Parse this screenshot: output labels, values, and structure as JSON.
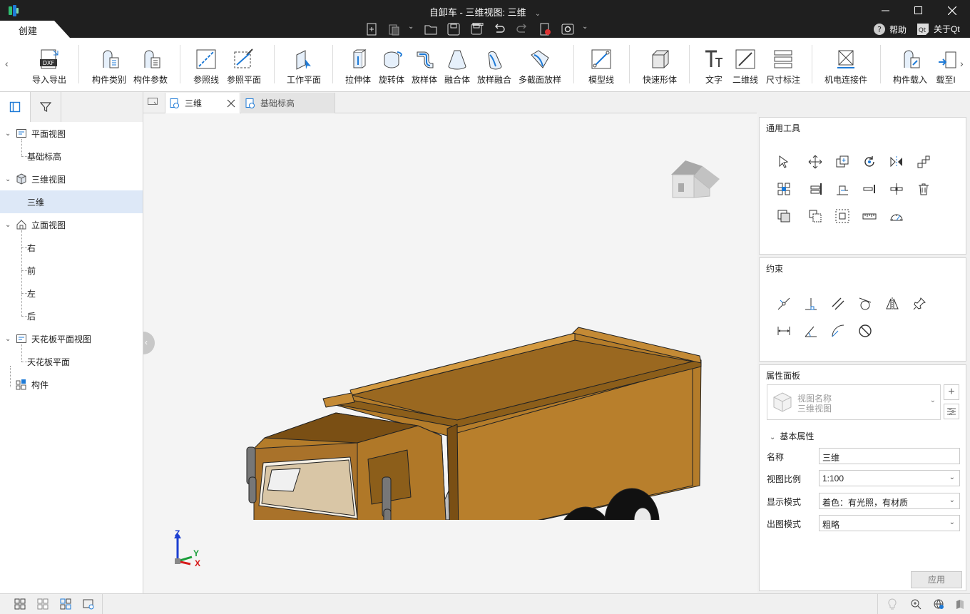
{
  "window": {
    "title": "自卸车 - 三维视图: 三维",
    "accent": "#1e7ad6"
  },
  "ribbon_tab": "创建",
  "help": {
    "help_label": "帮助",
    "about_label": "关于Qt"
  },
  "ribbon": {
    "buttons": [
      {
        "label": "导入导出",
        "icon": "dxf-icon"
      },
      {
        "label": "构件类别",
        "icon": "component-category-icon"
      },
      {
        "label": "构件参数",
        "icon": "component-params-icon"
      },
      {
        "label": "参照线",
        "icon": "reference-line-icon"
      },
      {
        "label": "参照平面",
        "icon": "reference-plane-icon"
      },
      {
        "label": "工作平面",
        "icon": "work-plane-icon"
      },
      {
        "label": "拉伸体",
        "icon": "extrusion-icon"
      },
      {
        "label": "旋转体",
        "icon": "revolve-icon"
      },
      {
        "label": "放样体",
        "icon": "sweep-icon"
      },
      {
        "label": "融合体",
        "icon": "blend-icon"
      },
      {
        "label": "放样融合",
        "icon": "swept-blend-icon"
      },
      {
        "label": "多截面放样",
        "icon": "multi-section-loft-icon"
      },
      {
        "label": "模型线",
        "icon": "model-line-icon"
      },
      {
        "label": "快速形体",
        "icon": "quick-shape-icon"
      },
      {
        "label": "文字",
        "icon": "text-icon"
      },
      {
        "label": "二维线",
        "icon": "2d-line-icon"
      },
      {
        "label": "尺寸标注",
        "icon": "dimension-icon"
      },
      {
        "label": "机电连接件",
        "icon": "mep-connector-icon"
      },
      {
        "label": "构件载入",
        "icon": "component-load-icon"
      },
      {
        "label": "载至I",
        "icon": "load-into-icon"
      }
    ]
  },
  "tree": {
    "items": [
      {
        "label": "平面视图",
        "level": 0,
        "expanded": true,
        "icon": "plan-view-icon"
      },
      {
        "label": "基础标高",
        "level": 1
      },
      {
        "label": "三维视图",
        "level": 0,
        "expanded": true,
        "icon": "3d-view-icon"
      },
      {
        "label": "三维",
        "level": 1,
        "selected": true
      },
      {
        "label": "立面视图",
        "level": 0,
        "expanded": true,
        "icon": "elevation-view-icon"
      },
      {
        "label": "右",
        "level": 1
      },
      {
        "label": "前",
        "level": 1
      },
      {
        "label": "左",
        "level": 1
      },
      {
        "label": "后",
        "level": 1
      },
      {
        "label": "天花板平面视图",
        "level": 0,
        "expanded": true,
        "icon": "ceiling-plan-icon"
      },
      {
        "label": "天花板平面",
        "level": 1
      },
      {
        "label": "构件",
        "level": 0,
        "expanded": false,
        "icon": "components-icon"
      }
    ]
  },
  "doc_tabs": [
    {
      "label": "三维",
      "active": true
    },
    {
      "label": "基础标高",
      "active": false
    }
  ],
  "axes": {
    "z": "Z",
    "y": "Y",
    "x": "X"
  },
  "panels": {
    "general_tools": {
      "title": "通用工具"
    },
    "constraints": {
      "title": "约束"
    },
    "properties": {
      "title": "属性面板",
      "type_name": "视图名称",
      "type_value": "三维视图",
      "section": "基本属性",
      "rows": [
        {
          "label": "名称",
          "value": "三维",
          "dropdown": false
        },
        {
          "label": "视图比例",
          "value": "1:100",
          "dropdown": true
        },
        {
          "label": "显示模式",
          "value": "着色：有光照，有材质",
          "dropdown": true
        },
        {
          "label": "出图模式",
          "value": "粗略",
          "dropdown": true
        }
      ],
      "apply_label": "应用"
    }
  }
}
